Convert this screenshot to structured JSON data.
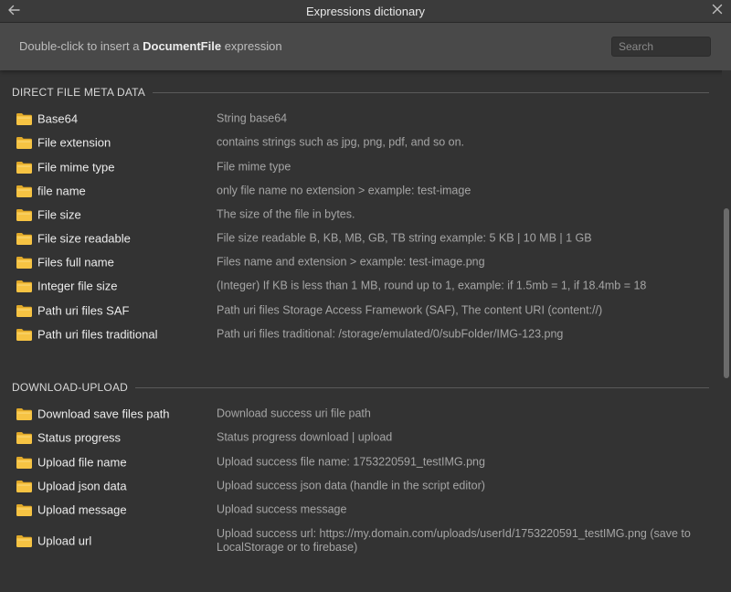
{
  "window": {
    "title": "Expressions dictionary"
  },
  "hint": {
    "prefix": "Double-click to insert a ",
    "bold": "DocumentFile",
    "suffix": " expression"
  },
  "search": {
    "placeholder": "Search",
    "value": ""
  },
  "sections": [
    {
      "title": "DIRECT FILE META DATA",
      "items": [
        {
          "name": "Base64",
          "desc": "String base64"
        },
        {
          "name": "File extension",
          "desc": "contains strings such as jpg, png, pdf, and so on."
        },
        {
          "name": "File mime type",
          "desc": "File mime type"
        },
        {
          "name": "file name",
          "desc": "only file name no extension > example: test-image"
        },
        {
          "name": "File size",
          "desc": "The size of the file in bytes."
        },
        {
          "name": "File size readable",
          "desc": "File size readable B, KB, MB, GB, TB string example: 5 KB | 10 MB | 1 GB"
        },
        {
          "name": "Files full name",
          "desc": "Files name and extension > example: test-image.png"
        },
        {
          "name": "Integer file size",
          "desc": "(Integer) If KB is less than 1 MB, round up to 1, example: if 1.5mb = 1, if 18.4mb = 18"
        },
        {
          "name": "Path uri files SAF",
          "desc": "Path uri files Storage Access Framework (SAF), The content URI (content://)"
        },
        {
          "name": "Path uri files traditional",
          "desc": "Path uri files traditional: /storage/emulated/0/subFolder/IMG-123.png"
        }
      ]
    },
    {
      "title": "DOWNLOAD-UPLOAD",
      "items": [
        {
          "name": "Download save files path",
          "desc": "Download success uri file path"
        },
        {
          "name": "Status progress",
          "desc": "Status progress download | upload"
        },
        {
          "name": "Upload file name",
          "desc": "Upload success file name: 1753220591_testIMG.png"
        },
        {
          "name": "Upload json data",
          "desc": "Upload success json data (handle in the script editor)"
        },
        {
          "name": "Upload message",
          "desc": "Upload success message"
        },
        {
          "name": "Upload url",
          "desc": "Upload success url: https://my.domain.com/uploads/userId/1753220591_testIMG.png (save to LocalStorage or to firebase)"
        }
      ]
    }
  ],
  "colors": {
    "folder": "#f6c343",
    "folder_tab": "#e0a92a",
    "background": "#333333",
    "hintbar": "#494949"
  },
  "icons": {
    "back": "arrow-left-icon",
    "close": "close-icon",
    "folder": "folder-icon"
  }
}
